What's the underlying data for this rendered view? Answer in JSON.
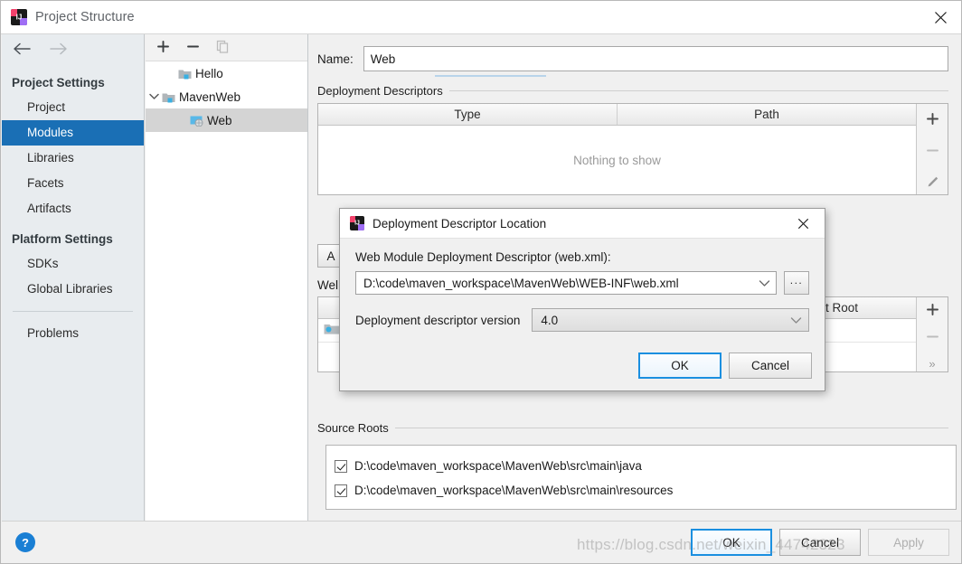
{
  "window": {
    "title": "Project Structure",
    "icon": "intellij-logo",
    "close_icon": "close-icon"
  },
  "sidebar": {
    "back_icon": "back-arrow-icon",
    "forward_icon": "forward-arrow-icon",
    "sections": [
      {
        "group": "Project Settings",
        "items": [
          {
            "label": "Project",
            "selected": false
          },
          {
            "label": "Modules",
            "selected": true
          },
          {
            "label": "Libraries",
            "selected": false
          },
          {
            "label": "Facets",
            "selected": false
          },
          {
            "label": "Artifacts",
            "selected": false
          }
        ]
      },
      {
        "group": "Platform Settings",
        "items": [
          {
            "label": "SDKs",
            "selected": false
          },
          {
            "label": "Global Libraries",
            "selected": false
          }
        ]
      }
    ],
    "problems": {
      "label": "Problems",
      "selected": false
    }
  },
  "tree": {
    "toolbar": [
      {
        "icon": "plus-icon",
        "name": "add-module-button",
        "enabled": true
      },
      {
        "icon": "minus-icon",
        "name": "remove-module-button",
        "enabled": true
      },
      {
        "icon": "copy-icon",
        "name": "copy-module-button",
        "enabled": false
      }
    ],
    "nodes": [
      {
        "label": "Hello",
        "depth": 0,
        "icon": "module-folder-icon",
        "expandable": false,
        "expanded": false,
        "selected": false
      },
      {
        "label": "MavenWeb",
        "depth": 0,
        "icon": "module-folder-icon",
        "expandable": true,
        "expanded": true,
        "selected": false
      },
      {
        "label": "Web",
        "depth": 1,
        "icon": "web-facet-icon",
        "expandable": false,
        "expanded": false,
        "selected": true
      }
    ]
  },
  "content": {
    "name_label": "Name:",
    "name_value": "Web",
    "deployment_descriptors": {
      "title": "Deployment Descriptors",
      "columns": [
        "Type",
        "Path"
      ],
      "empty_text": "Nothing to show",
      "side_buttons": [
        {
          "icon": "plus-icon",
          "name": "add-descriptor-button",
          "enabled": true
        },
        {
          "icon": "minus-icon",
          "name": "remove-descriptor-button",
          "enabled": false
        },
        {
          "icon": "pencil-icon",
          "name": "edit-descriptor-button",
          "enabled": true
        }
      ]
    },
    "web_resource_directories": {
      "title_partial": "Wel",
      "add_button_partial": "A",
      "column_partial": "ment Root",
      "side_buttons": [
        {
          "icon": "plus-icon",
          "name": "add-web-resource-button",
          "enabled": true
        },
        {
          "icon": "minus-icon",
          "name": "remove-web-resource-button",
          "enabled": false
        },
        {
          "icon": "chevrons-right-icon",
          "name": "expand-web-resource-button",
          "enabled": true
        }
      ]
    },
    "source_roots": {
      "title": "Source Roots",
      "items": [
        {
          "label": "D:\\code\\maven_workspace\\MavenWeb\\src\\main\\java",
          "checked": true
        },
        {
          "label": "D:\\code\\maven_workspace\\MavenWeb\\src\\main\\resources",
          "checked": true
        }
      ]
    }
  },
  "bottom_bar": {
    "help_icon": "question-mark-icon",
    "buttons": [
      {
        "label": "OK",
        "state": "focused"
      },
      {
        "label": "Cancel",
        "state": "normal"
      },
      {
        "label": "Apply",
        "state": "disabled"
      }
    ]
  },
  "modal": {
    "icon": "intellij-logo",
    "title": "Deployment Descriptor Location",
    "close_icon": "close-icon",
    "descriptor_label": "Web Module Deployment Descriptor (web.xml):",
    "descriptor_path": "D:\\code\\maven_workspace\\MavenWeb\\WEB-INF\\web.xml",
    "dropdown_icon": "chevron-down-icon",
    "browse_label": "...",
    "version_label": "Deployment descriptor version",
    "version_value": "4.0",
    "version_dropdown_icon": "chevron-down-icon",
    "buttons": [
      {
        "label": "OK",
        "state": "focused"
      },
      {
        "label": "Cancel",
        "state": "normal"
      }
    ]
  },
  "watermark": {
    "text": "https://blog.csdn.net/weixin_44742323"
  },
  "colors": {
    "accent": "#1a6fb5",
    "focus": "#1a8fe0",
    "help": "#1a7fd4",
    "sidebar_bg": "#e8ecef",
    "panel_bg": "#f0f0f0"
  }
}
